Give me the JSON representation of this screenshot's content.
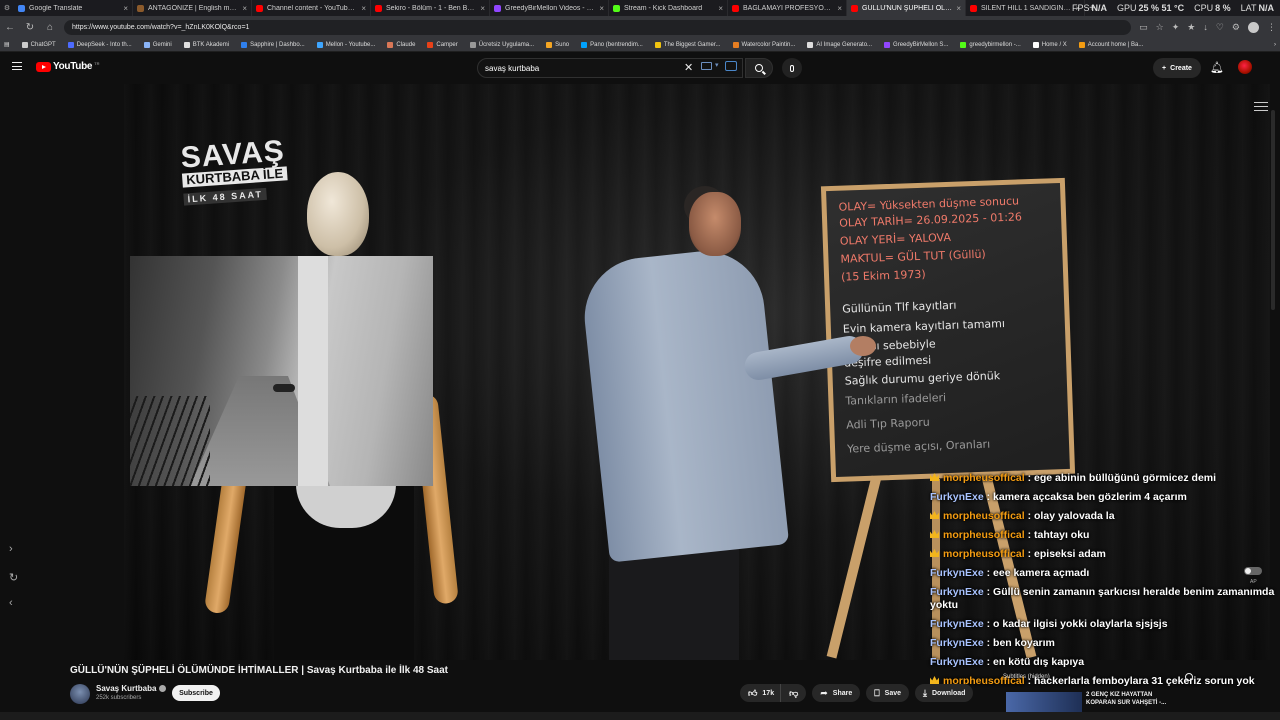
{
  "browser": {
    "tabs": [
      {
        "title": "Google Translate",
        "color": "#4285f4",
        "active": false
      },
      {
        "title": "ANTAGONIZE | English meaning -",
        "color": "#8b5a2b",
        "active": false
      },
      {
        "title": "Channel content - YouTube Studio",
        "color": "#ff0000",
        "active": false
      },
      {
        "title": "Sekiro - Bölüm - 1 - Ben Bu Oyunu",
        "color": "#ff0000",
        "active": false
      },
      {
        "title": "GreedyBirMellon Videos - Watch",
        "color": "#9146ff",
        "active": false
      },
      {
        "title": "Stream - Kick Dashboard",
        "color": "#53fc18",
        "active": false
      },
      {
        "title": "BAĞLAMAYI PROFESYONEL ÇALM",
        "color": "#ff0000",
        "active": false
      },
      {
        "title": "GÜLLÜ'NÜN ŞÜPHELİ ÖLÜM",
        "color": "#ff0000",
        "active": true
      },
      {
        "title": "SILENT HILL 1 SANDIĞINIZDAN",
        "color": "#ff0000",
        "active": false
      }
    ],
    "stats": {
      "fps_label": "FPS",
      "fps_value": "N/A",
      "gpu_label": "GPU",
      "gpu_value": "25 % 51 °C",
      "cpu_label": "CPU",
      "cpu_value": "8 %",
      "lat_label": "LAT",
      "lat_value": "N/A"
    },
    "url": "https://www.youtube.com/watch?v=_hZnLK0KOlQ&rco=1",
    "bookmarks": [
      {
        "label": "ChatGPT",
        "color": "#cccccc"
      },
      {
        "label": "DeepSeek - Into th...",
        "color": "#4d6bfe"
      },
      {
        "label": "Gemini",
        "color": "#8ab4f8"
      },
      {
        "label": "BTK Akademi",
        "color": "#e0e0e0"
      },
      {
        "label": "Sapphire | Dashbo...",
        "color": "#2f80ed"
      },
      {
        "label": "Mellon - Youtube...",
        "color": "#3ea6ff"
      },
      {
        "label": "Claude",
        "color": "#d97757"
      },
      {
        "label": "Camper",
        "color": "#e84118"
      },
      {
        "label": "Ücretsiz Uygulama...",
        "color": "#999999"
      },
      {
        "label": "Suno",
        "color": "#f5a623"
      },
      {
        "label": "Pano (bentrendim...",
        "color": "#00a2ff"
      },
      {
        "label": "The Biggest Gamer...",
        "color": "#f1c40f"
      },
      {
        "label": "Watercolor Paintin...",
        "color": "#e67e22"
      },
      {
        "label": "AI Image Generato...",
        "color": "#dddddd"
      },
      {
        "label": "GreedyBirMellon S...",
        "color": "#9146ff"
      },
      {
        "label": "greedybirmellon -...",
        "color": "#53fc18"
      },
      {
        "label": "Home / X",
        "color": "#ffffff"
      },
      {
        "label": "Account home | Ba...",
        "color": "#f39c12"
      }
    ]
  },
  "youtube": {
    "logo_text": "YouTube",
    "region": "TR",
    "search_value": "savaş kurtbaba",
    "create_label": "Create"
  },
  "video": {
    "show_logo": {
      "line1": "SAVAŞ",
      "line2": "KURTBABA İLE",
      "line3": "İLK 48 SAAT"
    },
    "board_lines": [
      {
        "text": "OLAY= Yüksekten düşme sonucu",
        "cls": "red"
      },
      {
        "text": "OLAY TARİH= 26.09.2025 - 01:26",
        "cls": "red"
      },
      {
        "text": "OLAY YERİ= YALOVA",
        "cls": "red"
      },
      {
        "text": "MAKTUL= GÜL TUT (Güllü)",
        "cls": "red"
      },
      {
        "text": "(15 Ekim 1973)",
        "cls": "red"
      },
      {
        "text": "Güllünün Tlf kayıtları",
        "cls": "white"
      },
      {
        "text": "Evin kamera kayıtları tamamı",
        "cls": "white"
      },
      {
        "text": "olması sebebiyle",
        "cls": "white"
      },
      {
        "text": "deşifre edilmesi",
        "cls": "white"
      },
      {
        "text": "Sağlık durumu geriye dönük",
        "cls": "white"
      },
      {
        "text": "Tanıkların ifadeleri",
        "cls": "faint"
      },
      {
        "text": "Adli Tıp Raporu",
        "cls": "faint"
      },
      {
        "text": "Yere düşme açısı, Oranları",
        "cls": "faint"
      }
    ]
  },
  "chat": [
    {
      "user": "morpheusoffical",
      "mod": true,
      "color": "gold",
      "msg": " : ege abinin büllüğünü görmicez demi"
    },
    {
      "user": "FurkynExe",
      "mod": false,
      "color": "blue",
      "msg": " : kamera açcaksa ben gözlerim 4 açarım"
    },
    {
      "user": "morpheusoffical",
      "mod": true,
      "color": "gold",
      "msg": " : olay yalovada la"
    },
    {
      "user": "morpheusoffical",
      "mod": true,
      "color": "gold",
      "msg": " : tahtayı oku"
    },
    {
      "user": "morpheusoffical",
      "mod": true,
      "color": "gold",
      "msg": " : episeksi adam"
    },
    {
      "user": "FurkynExe",
      "mod": false,
      "color": "blue",
      "msg": " : eee kamera açmadı"
    },
    {
      "user": "FurkynExe",
      "mod": false,
      "color": "blue",
      "msg": " : Güllü senin zamanın şarkıcısı heralde benim zamanımda yoktu"
    },
    {
      "user": "FurkynExe",
      "mod": false,
      "color": "blue",
      "msg": " : o kadar ilgisi yokki olaylarla sjsjsjs"
    },
    {
      "user": "FurkynExe",
      "mod": false,
      "color": "blue",
      "msg": " : ben koyarım"
    },
    {
      "user": "FurkynExe",
      "mod": false,
      "color": "blue",
      "msg": " : en kötü dış kapıya"
    },
    {
      "user": "morpheusoffical",
      "mod": true,
      "color": "gold",
      "msg": " : hackerlarla femboylara 31 çekeriz sorun yok"
    }
  ],
  "below": {
    "title": "GÜLLÜ'NÜN ŞÜPHELİ ÖLÜMÜNDE İHTİMALLER | Savaş Kurtbaba ile İlk 48 Saat",
    "channel": "Savaş Kurtbaba",
    "subscribers": "252k subscribers",
    "subscribe_label": "Subscribe",
    "likes": "17k",
    "share_label": "Share",
    "save_label": "Save",
    "download_label": "Download",
    "subtitles_status": "Subtitles (hidden)",
    "ap_label": "AP",
    "rec_title": "2 GENÇ KIZ HAYATTAN KOPARAN SUR VAHŞETİ -..."
  },
  "colors": {
    "accent": "#ff0000",
    "mod_gold": "#f39c12",
    "user_blue": "#a9c3ff"
  }
}
